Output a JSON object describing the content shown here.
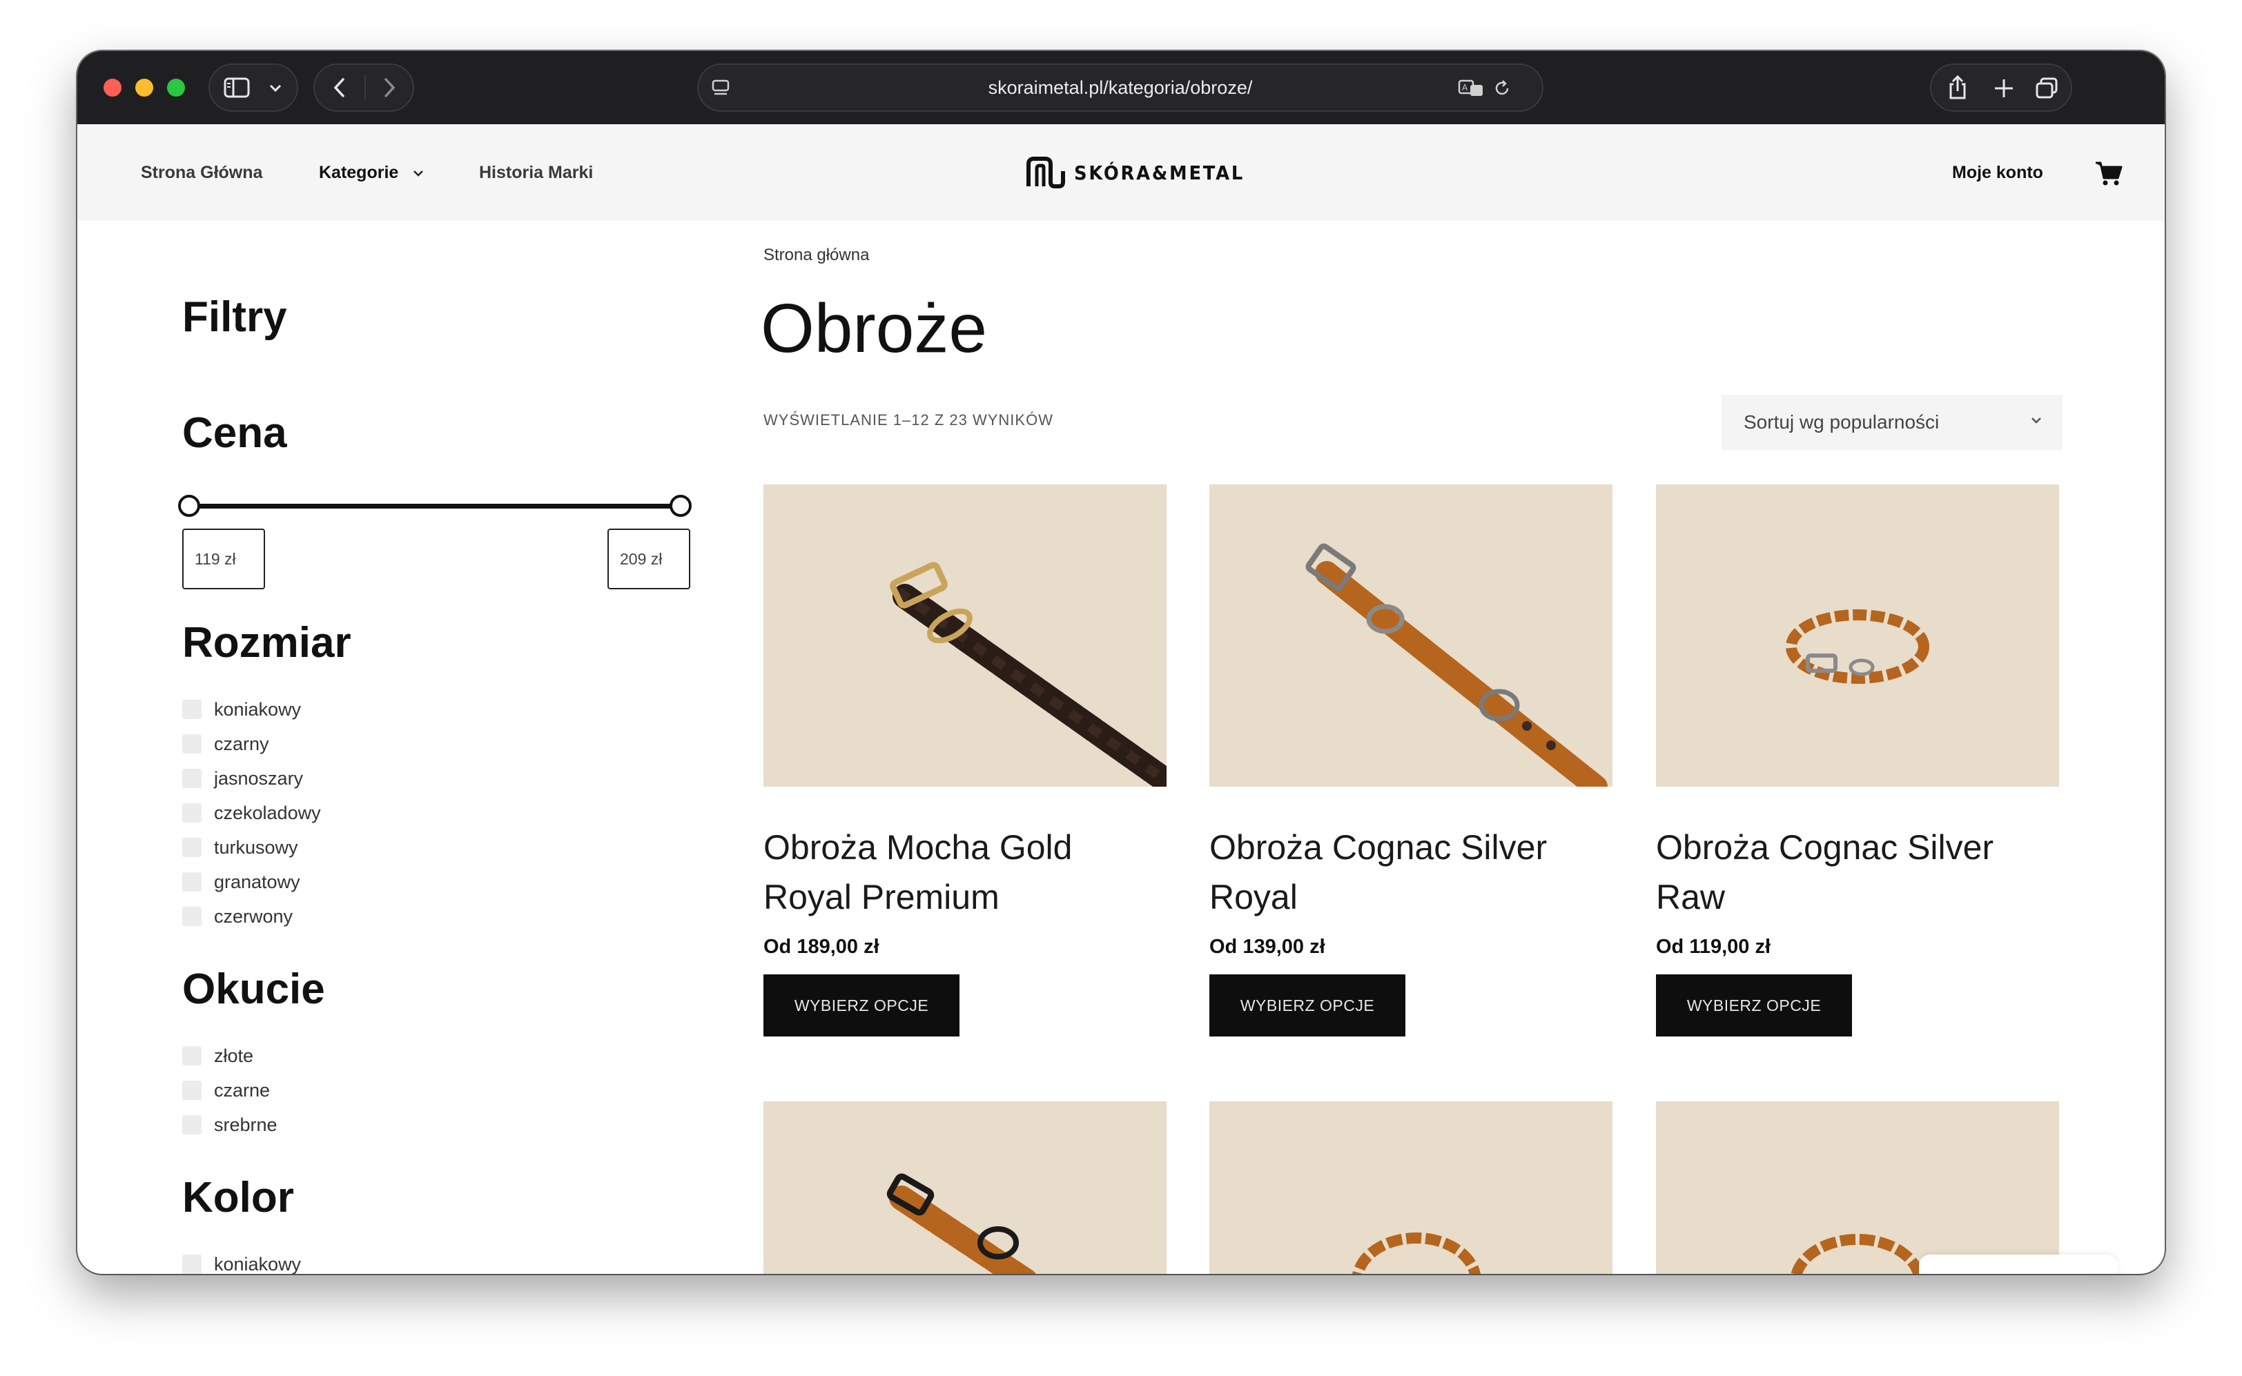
{
  "browser": {
    "url": "skoraimetal.pl/kategoria/obroze/"
  },
  "header": {
    "nav": [
      "Strona Główna",
      "Kategorie",
      "Historia Marki"
    ],
    "logo_text": "SKÓRA&METAL",
    "account": "Moje konto"
  },
  "sidebar": {
    "title": "Filtry",
    "price": {
      "heading": "Cena",
      "min": "119 zł",
      "max": "209 zł"
    },
    "size": {
      "heading": "Rozmiar",
      "options": [
        "koniakowy",
        "czarny",
        "jasnoszary",
        "czekoladowy",
        "turkusowy",
        "granatowy",
        "czerwony"
      ]
    },
    "fitting": {
      "heading": "Okucie",
      "options": [
        "złote",
        "czarne",
        "srebrne"
      ]
    },
    "color": {
      "heading": "Kolor",
      "options": [
        "koniakowy"
      ]
    }
  },
  "main": {
    "breadcrumb": "Strona główna",
    "title": "Obroże",
    "results": "WYŚWIETLANIE 1–12 Z 23 WYNIKÓW",
    "sort": "Sortuj wg popularności",
    "products": [
      {
        "name": "Obroża Mocha Gold Royal Premium",
        "price": "Od 189,00 zł",
        "button": "WYBIERZ OPCJE"
      },
      {
        "name": "Obroża Cognac Silver Royal",
        "price": "Od 139,00 zł",
        "button": "WYBIERZ OPCJE"
      },
      {
        "name": "Obroża Cognac Silver Raw",
        "price": "Od 119,00 zł",
        "button": "WYBIERZ OPCJE"
      }
    ]
  },
  "colors": {
    "accent": "#0e0e0e",
    "card_bg": "#e8dccb",
    "leather_cognac": "#b5651d",
    "leather_mocha": "#2a1c16"
  }
}
